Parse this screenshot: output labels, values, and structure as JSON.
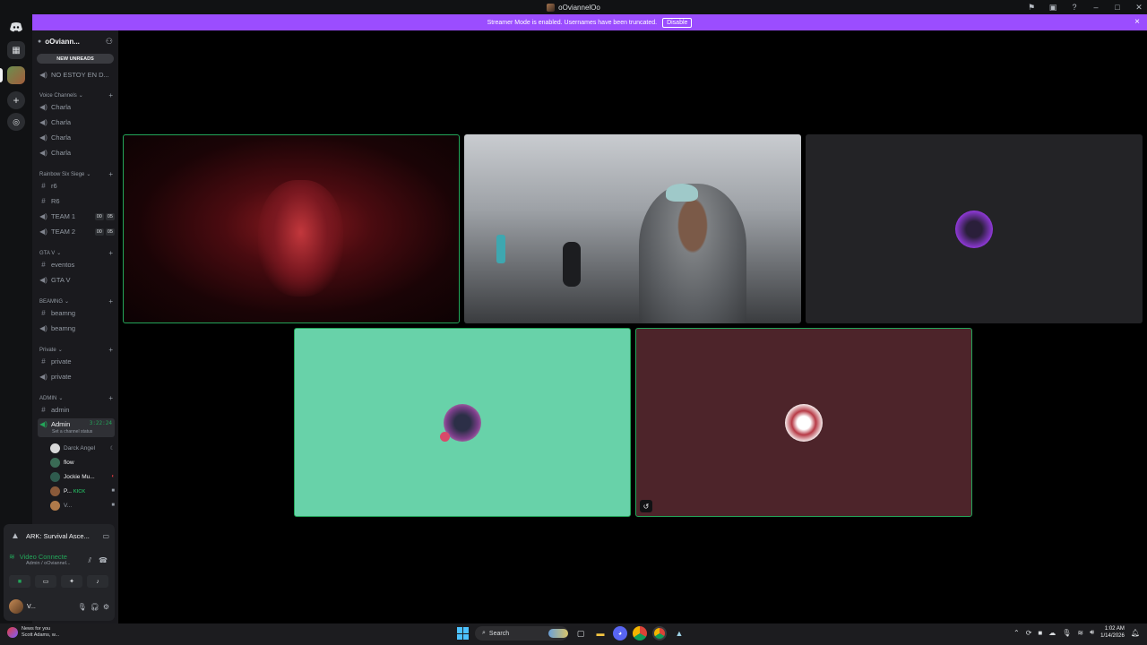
{
  "window": {
    "title": "oOviannelOo"
  },
  "banner": {
    "text": "Streamer Mode is enabled. Usernames have been truncated.",
    "disable_label": "Disable",
    "close_icon": "×"
  },
  "server": {
    "name": "oOviann...",
    "new_unreads": "NEW UNREADS",
    "first_channel": "NO ESTOY EN D..."
  },
  "categories": [
    {
      "name": "Voice Channels",
      "channels": [
        {
          "name": "Charla",
          "type": "voice"
        },
        {
          "name": "Charla",
          "type": "voice"
        },
        {
          "name": "Charla",
          "type": "voice"
        },
        {
          "name": "Charla",
          "type": "voice"
        }
      ]
    },
    {
      "name": "Rainbow Six Siege",
      "channels": [
        {
          "name": "r6",
          "type": "text"
        },
        {
          "name": "R6",
          "type": "text"
        },
        {
          "name": "TEAM 1",
          "type": "voice",
          "badge": [
            "00",
            "05"
          ]
        },
        {
          "name": "TEAM 2",
          "type": "voice",
          "badge": [
            "00",
            "05"
          ]
        }
      ]
    },
    {
      "name": "GTA V",
      "channels": [
        {
          "name": "eventos",
          "type": "text"
        },
        {
          "name": "GTA V",
          "type": "voice"
        }
      ]
    },
    {
      "name": "BEAMNG",
      "channels": [
        {
          "name": "beamng",
          "type": "text"
        },
        {
          "name": "beamng",
          "type": "voice"
        }
      ]
    },
    {
      "name": "Private",
      "channels": [
        {
          "name": "private",
          "type": "text"
        },
        {
          "name": "private",
          "type": "voice"
        }
      ]
    },
    {
      "name": "ADMIN",
      "channels": [
        {
          "name": "admin",
          "type": "text"
        }
      ]
    }
  ],
  "active_channel": {
    "name": "Admin",
    "time": "3:22:24",
    "status": "Set a channel status"
  },
  "voice_users": [
    {
      "name": "Darck Angel",
      "extra": ""
    },
    {
      "name": "flow",
      "extra": ""
    },
    {
      "name": "Jockie Mu...",
      "extra": ""
    },
    {
      "name": "P...",
      "extra": "KICK"
    },
    {
      "name": "V...",
      "extra": ""
    }
  ],
  "activity": {
    "label": "ARK: Survival Asce..."
  },
  "voice_connection": {
    "title": "Video Connecte",
    "subtitle": "Admin / oOviannel..."
  },
  "user": {
    "name": "V..."
  },
  "taskbar": {
    "news_title": "News for you",
    "news_sub": "Scott Adams, w...",
    "search_label": "Search",
    "time": "1:02 AM",
    "date": "1/14/2026"
  },
  "colors": {
    "banner": "#9b4dff",
    "speaking": "#23a559",
    "tile_teal": "#68d2a9",
    "tile_maroon": "#4d242a",
    "tile_dark": "#232326"
  }
}
